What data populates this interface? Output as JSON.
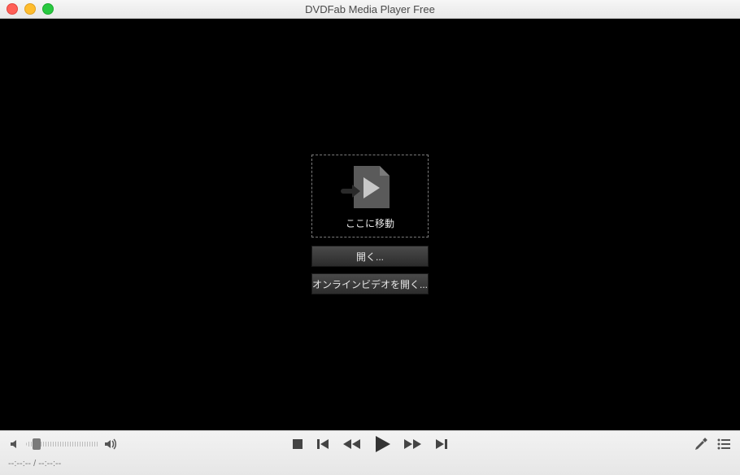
{
  "window": {
    "title": "DVDFab Media Player Free"
  },
  "drop": {
    "label": "ここに移動"
  },
  "buttons": {
    "open": "開く...",
    "open_online": "オンラインビデオを開く..."
  },
  "controls": {
    "names": {
      "mute": "mute-icon",
      "volmax": "volume-max-icon",
      "stop": "stop-button",
      "prev": "previous-button",
      "rw": "rewind-button",
      "play": "play-button",
      "ff": "fast-forward-button",
      "next": "next-button",
      "settings": "settings-button",
      "playlist": "playlist-button"
    }
  },
  "time": {
    "display": "--:--:-- / --:--:--"
  }
}
